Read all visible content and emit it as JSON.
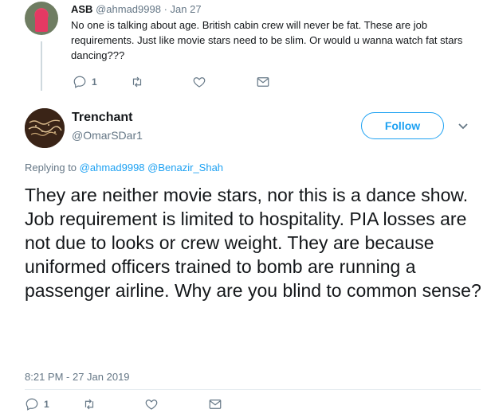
{
  "reply_tweet": {
    "name": "ASB",
    "handle": "@ahmad9998",
    "separator": "·",
    "date": "Jan 27",
    "text": "No one is talking about age. British cabin crew will never be fat. These are job requirements. Just like movie stars need to be slim. Or would u wanna watch fat stars dancing???",
    "reply_count": "1"
  },
  "main_tweet": {
    "name": "Trenchant",
    "handle": "@OmarSDar1",
    "follow_label": "Follow",
    "replying_prefix": "Replying to",
    "replying_to_1": "@ahmad9998",
    "replying_to_2": "@Benazir_Shah",
    "text": "They are neither movie stars, nor this is a dance show. Job requirement is limited to hospitality. PIA losses are not due to looks or crew weight. They are because uniformed officers trained to bomb are running a passenger airline. Why are you blind to common sense?",
    "timestamp": "8:21 PM - 27 Jan 2019",
    "reply_count": "1"
  },
  "icons": {
    "reply": "reply-icon",
    "retweet": "retweet-icon",
    "like": "like-icon",
    "dm": "direct-message-icon",
    "caret": "chevron-down-icon"
  },
  "colors": {
    "accent": "#1da1f2",
    "muted": "#657786",
    "text": "#14171a"
  }
}
